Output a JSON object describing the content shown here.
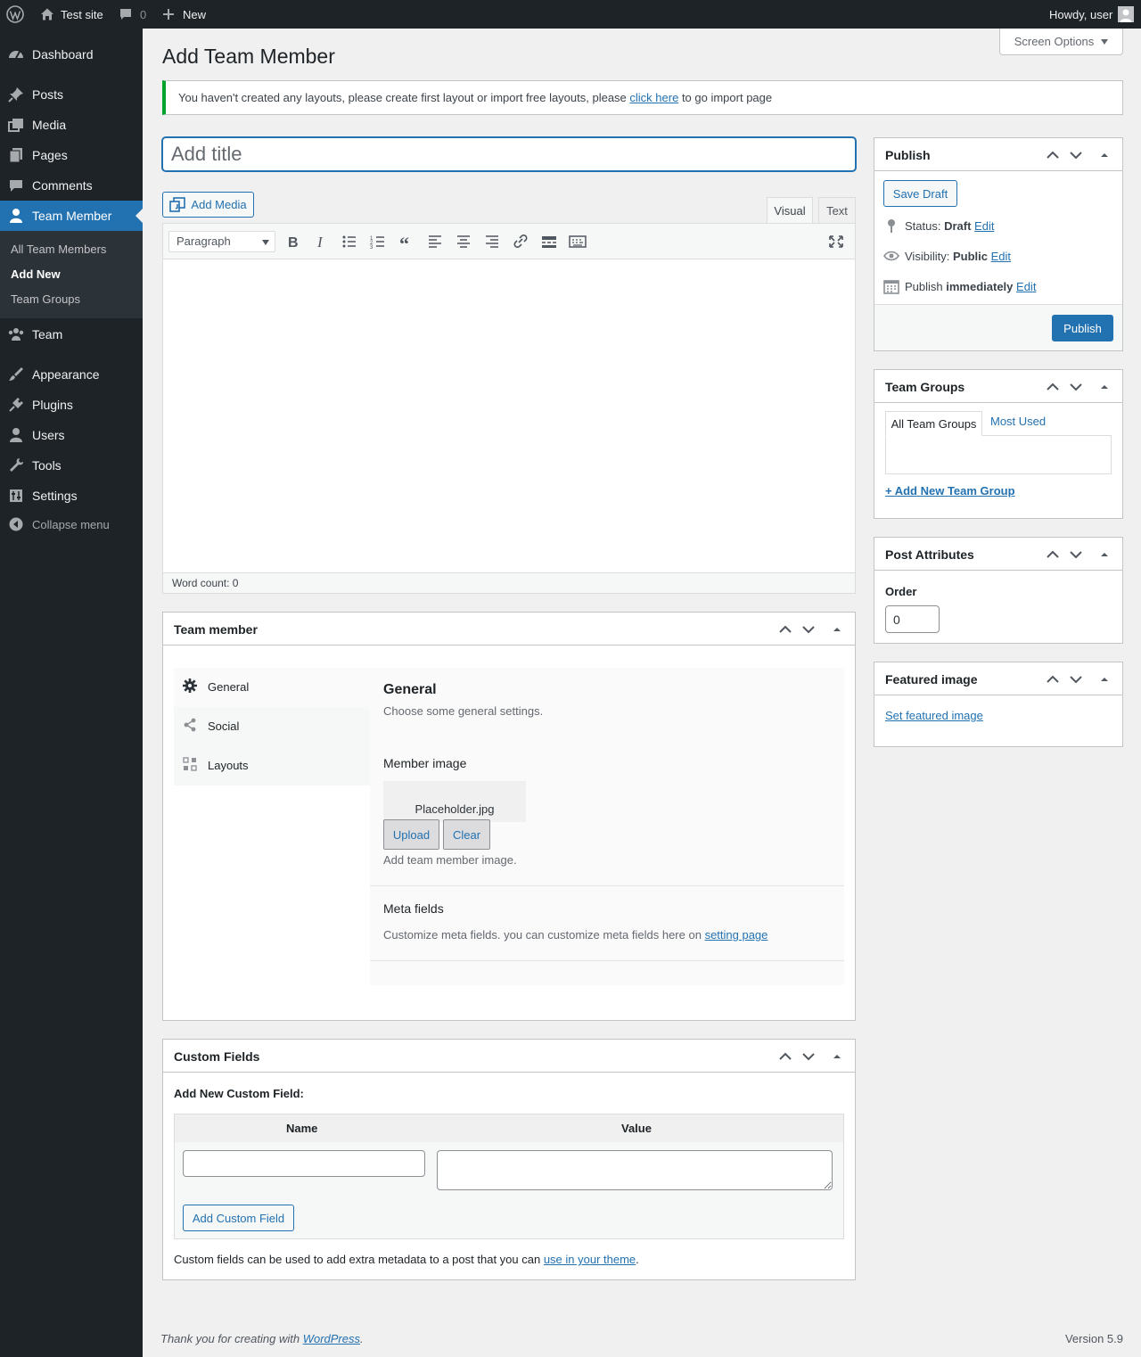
{
  "adminbar": {
    "site_name": "Test site",
    "comments_count": "0",
    "new_label": "New",
    "greeting": "Howdy, user"
  },
  "menu": {
    "items": [
      {
        "label": "Dashboard",
        "icon": "dashboard-icon"
      },
      {
        "label": "Posts",
        "icon": "pin-icon"
      },
      {
        "label": "Media",
        "icon": "media-icon"
      },
      {
        "label": "Pages",
        "icon": "pages-icon"
      },
      {
        "label": "Comments",
        "icon": "comment-icon"
      },
      {
        "label": "Team Member",
        "icon": "person-icon"
      },
      {
        "label": "Team",
        "icon": "groups-icon"
      },
      {
        "label": "Appearance",
        "icon": "brush-icon"
      },
      {
        "label": "Plugins",
        "icon": "plug-icon"
      },
      {
        "label": "Users",
        "icon": "user-icon"
      },
      {
        "label": "Tools",
        "icon": "wrench-icon"
      },
      {
        "label": "Settings",
        "icon": "settings-icon"
      }
    ],
    "submenu": [
      "All Team Members",
      "Add New",
      "Team Groups"
    ],
    "collapse_label": "Collapse menu"
  },
  "screen_options": "Screen Options",
  "page_title": "Add Team Member",
  "notice": {
    "text_before": "You haven't created any layouts, please create first layout or import free layouts, please ",
    "link": "click here",
    "text_after": " to go import page"
  },
  "title_placeholder": "Add title",
  "editor": {
    "add_media": "Add Media",
    "tab_visual": "Visual",
    "tab_text": "Text",
    "format": "Paragraph",
    "word_count": "Word count: 0"
  },
  "team_member_box": {
    "title": "Team member",
    "tabs": [
      "General",
      "Social",
      "Layouts"
    ],
    "section_title": "General",
    "section_desc": "Choose some general settings.",
    "member_image_label": "Member image",
    "placeholder_file": "Placeholder.jpg",
    "upload": "Upload",
    "clear": "Clear",
    "image_help": "Add team member image.",
    "meta_title": "Meta fields",
    "meta_desc": "Customize meta fields. you can customize meta fields here on ",
    "meta_link": "setting page"
  },
  "custom_fields": {
    "title": "Custom Fields",
    "add_new": "Add New Custom Field:",
    "col_name": "Name",
    "col_value": "Value",
    "button": "Add Custom Field",
    "help_before": "Custom fields can be used to add extra metadata to a post that you can ",
    "help_link": "use in your theme",
    "help_after": "."
  },
  "publish": {
    "title": "Publish",
    "save_draft": "Save Draft",
    "status_label": "Status: ",
    "status_value": "Draft",
    "visibility_label": "Visibility: ",
    "visibility_value": "Public",
    "publish_label": "Publish ",
    "publish_value": "immediately",
    "edit": "Edit",
    "publish_button": "Publish"
  },
  "team_groups": {
    "title": "Team Groups",
    "tab_all": "All Team Groups",
    "tab_used": "Most Used",
    "add_link": "+ Add New Team Group"
  },
  "post_attributes": {
    "title": "Post Attributes",
    "order_label": "Order",
    "order_value": "0"
  },
  "featured_image": {
    "title": "Featured image",
    "link": "Set featured image"
  },
  "footer": {
    "thanks_before": "Thank you for creating with ",
    "thanks_link": "WordPress",
    "thanks_after": ".",
    "version": "Version 5.9"
  },
  "colors": {
    "accent": "#2271b1",
    "menu_bg": "#1d2327",
    "notice_border": "#00a32a"
  }
}
